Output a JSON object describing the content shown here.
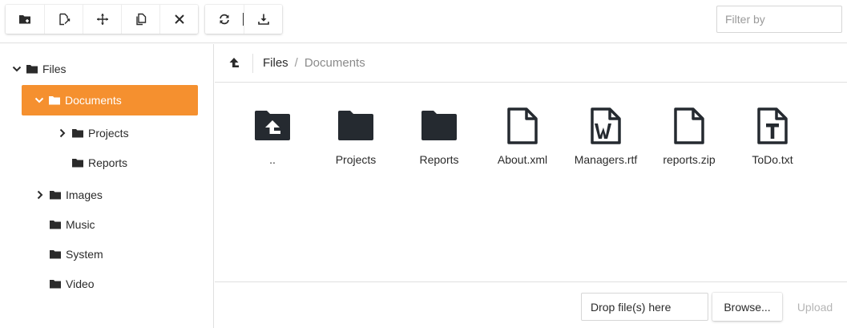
{
  "colors": {
    "accent": "#f5902f",
    "icon": "#2b2b2b",
    "border": "#e0e0e0",
    "muted": "#8a8a8a"
  },
  "toolbar": {
    "buttons": [
      {
        "name": "new-folder",
        "icon": "new-folder-icon"
      },
      {
        "name": "rename",
        "icon": "rename-icon"
      },
      {
        "name": "move",
        "icon": "move-icon"
      },
      {
        "name": "copy",
        "icon": "copy-icon"
      },
      {
        "name": "delete",
        "icon": "close-icon"
      },
      {
        "name": "refresh",
        "icon": "refresh-icon"
      },
      {
        "name": "download",
        "icon": "download-icon"
      }
    ],
    "filter_placeholder": "Filter by"
  },
  "tree": {
    "root": "Files",
    "items": [
      {
        "label": "Files",
        "expanded": true
      },
      {
        "label": "Documents",
        "expanded": true,
        "selected": true
      },
      {
        "label": "Projects",
        "expanded": false
      },
      {
        "label": "Reports"
      },
      {
        "label": "Images",
        "expanded": false
      },
      {
        "label": "Music"
      },
      {
        "label": "System"
      },
      {
        "label": "Video"
      }
    ]
  },
  "breadcrumb": {
    "items": [
      "Files",
      "Documents"
    ],
    "separator": "/"
  },
  "files": [
    {
      "name": "..",
      "type": "up-folder"
    },
    {
      "name": "Projects",
      "type": "folder"
    },
    {
      "name": "Reports",
      "type": "folder"
    },
    {
      "name": "About.xml",
      "type": "file"
    },
    {
      "name": "Managers.rtf",
      "type": "file-w"
    },
    {
      "name": "reports.zip",
      "type": "file"
    },
    {
      "name": "ToDo.txt",
      "type": "file-t"
    }
  ],
  "upload": {
    "drop_label": "Drop file(s) here",
    "browse_label": "Browse...",
    "upload_label": "Upload"
  }
}
